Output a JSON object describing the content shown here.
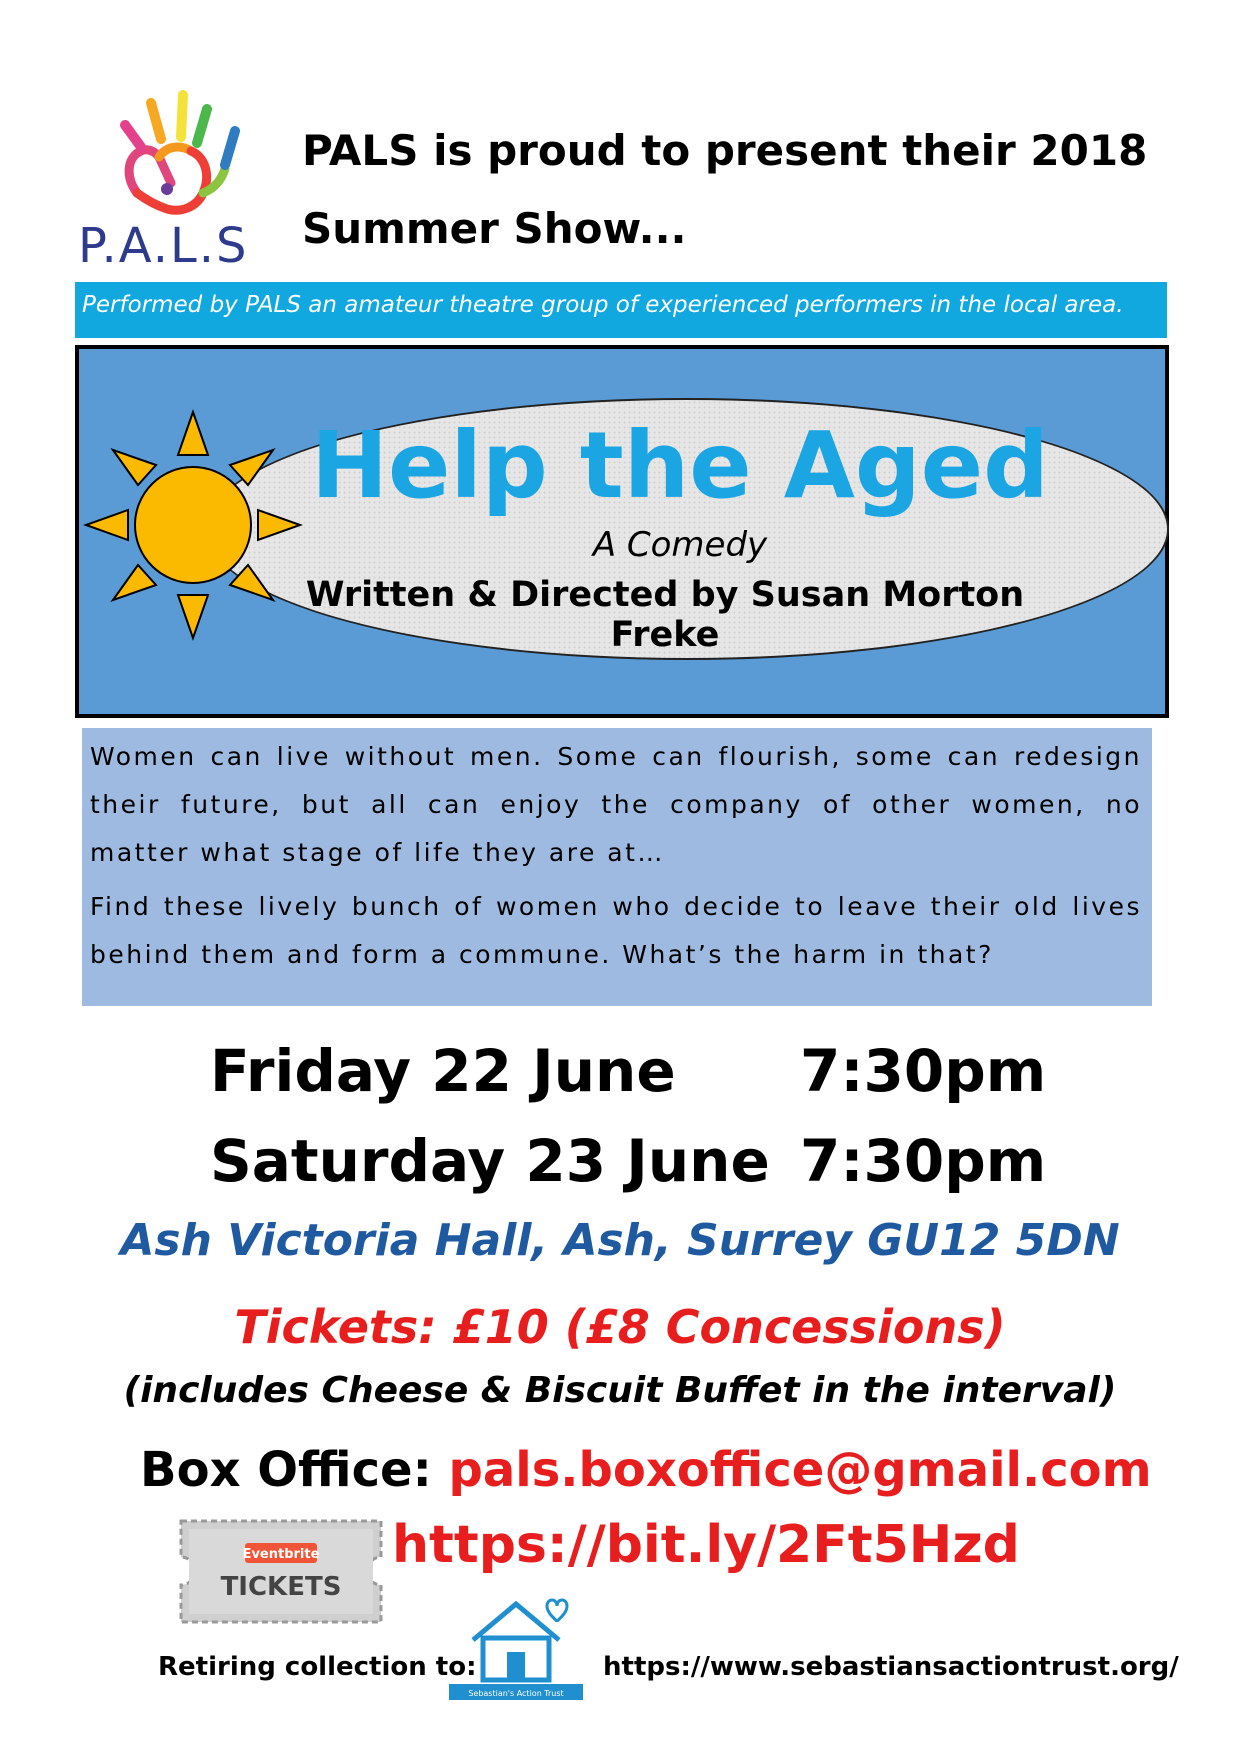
{
  "logo": {
    "text": "P.A.L.S",
    "icon": "rainbow-hand-icon"
  },
  "headline": {
    "line1": "PALS is proud to present their 2018",
    "line2": "Summer Show..."
  },
  "tagline": "Performed by PALS an amateur theatre group of experienced performers in the local area.",
  "show": {
    "title": "Help the Aged",
    "genre": "A Comedy",
    "credit": "Written & Directed by Susan Morton Freke",
    "icon": "sun-icon"
  },
  "description": {
    "paragraph1": "Women can live without men.  Some can flourish, some can redesign their future, but all can enjoy the company of other women, no matter what stage of life they are at…",
    "paragraph2": "Find these lively bunch of women who decide to leave their old lives behind them and form a commune.  What’s the harm in that?"
  },
  "performances": [
    {
      "day": "Friday 22 June",
      "time": "7:30pm"
    },
    {
      "day": "Saturday 23 June",
      "time": "7:30pm"
    }
  ],
  "venue": "Ash Victoria Hall, Ash, Surrey  GU12 5DN",
  "tickets": "Tickets: £10 (£8 Concessions)",
  "includes": "(includes Cheese & Biscuit Buffet in the interval)",
  "box_office": {
    "label": "Box Office:",
    "email": "pals.boxoffice@gmail.com",
    "url": "https://bit.ly/2Ft5Hzd",
    "eventbrite_badge": "Eventbrite",
    "eventbrite_tickets": "TICKETS"
  },
  "footer": {
    "retiring_label": "Retiring collection to:",
    "trust_name": "Sebastian's Action Trust",
    "trust_url": "https://www.sebastiansactiontrust.org/"
  },
  "colors": {
    "tagline_bar": "#11a8e0",
    "banner": "#5b9bd5",
    "title": "#1ca5e3",
    "description_bg": "#9ebae0",
    "venue": "#1f5aa0",
    "accent_red": "#e81e1e"
  }
}
